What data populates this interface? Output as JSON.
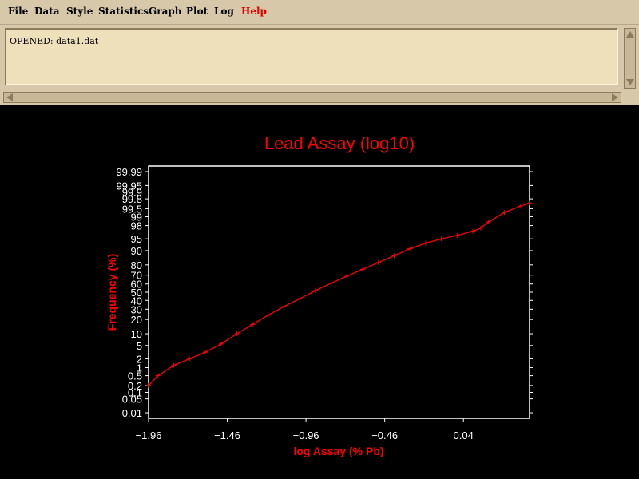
{
  "menu": {
    "items": [
      {
        "label": "File"
      },
      {
        "label": "Data"
      },
      {
        "label": "Style"
      },
      {
        "label": "Statistics"
      },
      {
        "label": "Graph"
      },
      {
        "label": "Plot"
      },
      {
        "label": "Log"
      },
      {
        "label": "Help"
      }
    ]
  },
  "log": {
    "text": "OPENED: data1.dat"
  },
  "colors": {
    "plot": "#ff0000",
    "background": "#000000",
    "axes": "#ffffff",
    "panel": "#d6c8a8"
  },
  "chart_data": {
    "type": "line",
    "title": "Lead Assay (log10)",
    "xlabel": "log Assay (% Pb)",
    "ylabel": "Frequency (%)",
    "xlim": [
      -1.96,
      0.46
    ],
    "xticks": [
      -1.96,
      -1.46,
      -0.96,
      -0.46,
      0.04
    ],
    "xtick_labels": [
      "−1.96",
      "−1.46",
      "−0.96",
      "−0.46",
      "0.04"
    ],
    "yscale": "probability",
    "ylim": [
      0.005,
      99.995
    ],
    "yticks": [
      0.01,
      0.05,
      0.1,
      0.2,
      0.5,
      1,
      2,
      5,
      10,
      20,
      30,
      40,
      50,
      60,
      70,
      80,
      90,
      95,
      98,
      99,
      99.5,
      99.8,
      99.9,
      99.95,
      99.99
    ],
    "ytick_labels": [
      "0.01",
      "0.05",
      "0.1",
      "0.2",
      "0.5",
      "1",
      "2",
      "5",
      "10",
      "20",
      "30",
      "40",
      "50",
      "60",
      "70",
      "80",
      "90",
      "95",
      "98",
      "99",
      "99.5",
      "99.8",
      "99.9",
      "99.95",
      "99.99"
    ],
    "marker": "+",
    "x": [
      -1.96,
      -1.9,
      -1.8,
      -1.7,
      -1.6,
      -1.5,
      -1.4,
      -1.3,
      -1.2,
      -1.1,
      -1.0,
      -0.9,
      -0.8,
      -0.7,
      -0.6,
      -0.5,
      -0.4,
      -0.3,
      -0.2,
      -0.1,
      0.0,
      0.1,
      0.15,
      0.2,
      0.3,
      0.4,
      0.46
    ],
    "y": [
      0.2,
      0.5,
      1.2,
      2.0,
      3.2,
      5.5,
      10.0,
      16.0,
      24.0,
      33.0,
      42.0,
      52.0,
      61.0,
      69.0,
      76.0,
      82.0,
      87.0,
      91.0,
      93.5,
      95.0,
      96.0,
      97.0,
      97.6,
      98.5,
      99.3,
      99.6,
      99.7
    ]
  }
}
